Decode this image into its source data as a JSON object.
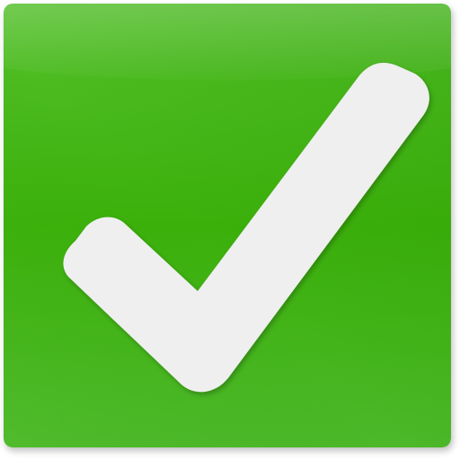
{
  "icon": {
    "name": "checkmark-icon",
    "colors": {
      "tile_light": "#55C12C",
      "tile_mid": "#3BB00A",
      "tile_dark": "#2C9A05",
      "check": "#EFEFEF"
    }
  }
}
